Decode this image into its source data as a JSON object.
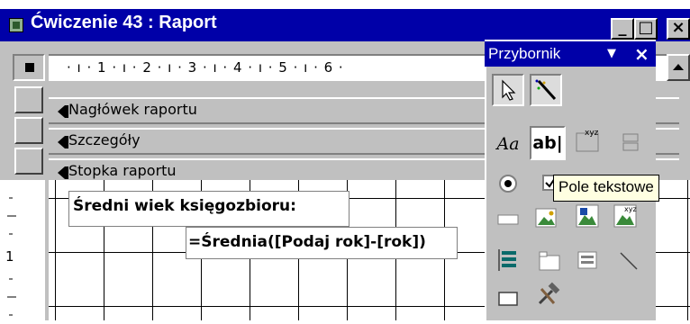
{
  "window": {
    "title": "Ćwiczenie 43 : Raport",
    "minimize_glyph": "_",
    "restore_glyph": "□",
    "close_glyph": "×"
  },
  "ruler": {
    "text": "· ı · 1 · ı · 2 · ı · 3 · ı · 4 · ı · 5 · ı · 6 ·"
  },
  "sections": {
    "header": "Nagłówek raportu",
    "details": "Szczegóły",
    "footer": "Stopka raportu"
  },
  "vertical_ruler": {
    "mark": "1"
  },
  "controls": {
    "label_text": "Średni wiek księgozbioru:",
    "textbox_text": "=Średnia([Podaj rok]-[rok])"
  },
  "toolbox": {
    "title": "Przybornik",
    "menu_glyph": "▼",
    "close_glyph": "×",
    "label_tool_text": "Aa",
    "textbox_tool_text": "ab|",
    "frame_tool_text": "xyz"
  },
  "tooltip": {
    "text": "Pole tekstowe"
  },
  "icons": [
    "form-icon",
    "minimize-icon",
    "restore-icon",
    "close-icon",
    "pointer-icon",
    "control-wizard-icon",
    "label-tool-icon",
    "textbox-tool-icon",
    "option-group-icon",
    "toggle-button-icon",
    "option-button-icon",
    "checkbox-icon",
    "combo-box-icon",
    "image-icon",
    "unbound-object-icon",
    "bound-object-icon",
    "list-box-icon",
    "tab-control-icon",
    "subform-icon",
    "line-icon",
    "rectangle-icon",
    "more-controls-icon"
  ],
  "colors": {
    "title_bar": "#0000a8",
    "face": "#c0c0c0",
    "tooltip_bg": "#ffffe1"
  }
}
